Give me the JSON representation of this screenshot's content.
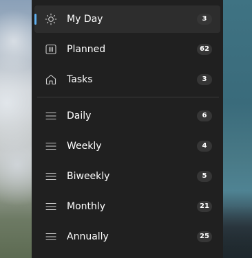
{
  "nav": {
    "smart_lists": [
      {
        "label": "My Day",
        "count": "3",
        "icon": "sun-icon",
        "selected": true
      },
      {
        "label": "Planned",
        "count": "62",
        "icon": "calendar-grid-icon"
      },
      {
        "label": "Tasks",
        "count": "3",
        "icon": "home-icon"
      }
    ],
    "lists": [
      {
        "label": "Daily",
        "count": "6",
        "icon": "list-lines-icon"
      },
      {
        "label": "Weekly",
        "count": "4",
        "icon": "list-lines-icon"
      },
      {
        "label": "Biweekly",
        "count": "5",
        "icon": "list-lines-icon"
      },
      {
        "label": "Monthly",
        "count": "21",
        "icon": "list-lines-icon"
      },
      {
        "label": "Annually",
        "count": "25",
        "icon": "list-lines-icon"
      }
    ]
  },
  "colors": {
    "accent": "#60b0f0",
    "panel": "#202020",
    "selected": "#2d2d2d",
    "badge": "#363636"
  }
}
